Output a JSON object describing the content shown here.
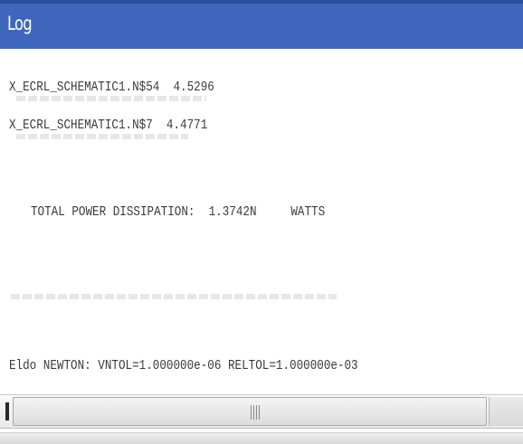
{
  "window": {
    "title": "Log"
  },
  "log": {
    "lines": [
      "X_ECRL_SCHEMATIC1.N$54  4.5296",
      "X_ECRL_SCHEMATIC1.N$7  4.4771",
      "TOTAL POWER DISSIPATION:  1.3742N     WATTS",
      "Eldo NEWTON: VNTOL=1.000000e-06 RELTOL=1.000000e-03"
    ]
  },
  "colors": {
    "title_bar": "#3f66bd",
    "title_text": "#ffffff",
    "log_text": "#3a3a3a"
  },
  "icons": {
    "scroll_grip": "grip-icon"
  }
}
